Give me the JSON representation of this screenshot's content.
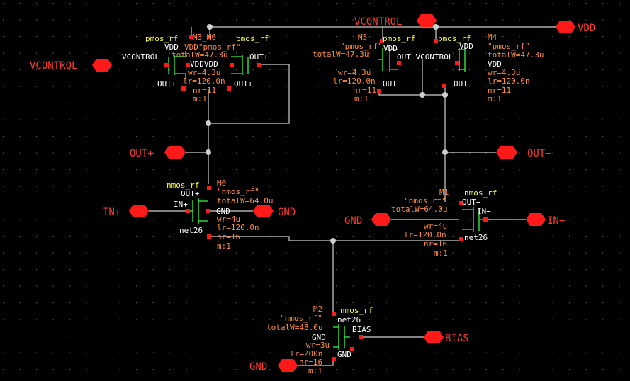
{
  "colors": {
    "background": "#000000",
    "wire": "#cfcfcf",
    "pin": "#ff1a1a",
    "pin_label": "#ff3b2f",
    "param": "#ff8c3a",
    "cell": "#ffff33",
    "net": "#ffffff",
    "device": "#33ff44",
    "grid": "#5a5a5a"
  },
  "pins": [
    {
      "id": "vcontrol-left",
      "label": "VCONTROL"
    },
    {
      "id": "vcontrol-top",
      "label": "VCONTROL"
    },
    {
      "id": "vdd",
      "label": "VDD"
    },
    {
      "id": "out-plus",
      "label": "OUT+"
    },
    {
      "id": "out-minus",
      "label": "OUT−"
    },
    {
      "id": "in-plus",
      "label": "IN+"
    },
    {
      "id": "gnd-m0",
      "label": "GND"
    },
    {
      "id": "gnd-m1",
      "label": "GND"
    },
    {
      "id": "in-minus",
      "label": "IN−"
    },
    {
      "id": "bias",
      "label": "BIAS"
    },
    {
      "id": "gnd-m2",
      "label": "GND"
    }
  ],
  "instances": {
    "m3m6": {
      "overlap_a": "pmos_rf",
      "overlap_b": "M3_M6",
      "overlap_c": "pmos_rf",
      "overlap_d": "VDD",
      "overlap_e": "VDD\"pmos_rf\"",
      "overlap_f": "totalW=47.3u",
      "overlap_g": "VCONTROL",
      "overlap_h": "VDDVDD",
      "overlap_i": "OUT+",
      "overlap_j": "wr=4.3u",
      "overlap_k": "OUT+",
      "overlap_l": "lr=120.0n",
      "overlap_m": "OUT+",
      "overlap_n": "nr=11",
      "overlap_o": "m:1"
    },
    "m5": {
      "name": "M5",
      "cell": "pmos_rf",
      "model": "\"pmos_rf\"",
      "totalW": "totalW=47.3u",
      "wr": "wr=4.3u",
      "lr": "lr=120.0n",
      "nr": "nr=11",
      "m": "m:1",
      "t_vdd": "VDD",
      "t_gate": "OUT−VCONTROL",
      "t_drain": "OUT−"
    },
    "m4": {
      "name": "M4",
      "cell": "pmos_rf",
      "model": "\"pmos_rf\"",
      "totalW": "totalW=47.3u",
      "wr": "wr=4.3u",
      "lr": "lr=120.0n",
      "nr": "nr=11",
      "m": "m:1",
      "t_vdd": "VDD",
      "t_vdd2": "VDD",
      "t_drain": "OUT−"
    },
    "m0": {
      "name": "M0",
      "cell": "nmos_rf",
      "model": "\"nmos_rf\"",
      "totalW": "totalW=64.0u",
      "wr": "wr=4u",
      "lr": "lr=120.0n",
      "nr": "nr=16",
      "m": "m:1",
      "t_drain": "OUT+",
      "t_gate": "IN+",
      "t_body": "GND",
      "t_source": "net26"
    },
    "m1": {
      "name": "M1",
      "cell": "nmos_rf",
      "model": "\"nmos_rf\"",
      "totalW": "totalW=64.0u",
      "wr": "wr=4u",
      "lr": "lr=120.0n",
      "nr": "nr=16",
      "m": "m:1",
      "t_drain": "OUT−",
      "t_gate": "IN−",
      "t_source": "net26"
    },
    "m2": {
      "name": "M2",
      "cell": "nmos_rf",
      "model": "\"nmos_rf\"",
      "totalW": "totalW=48.0u",
      "wr": "wr=3u",
      "lr": "lr=200n",
      "nr": "nr=16",
      "m": "m:1",
      "t_drain": "net26",
      "t_gate": "BIAS",
      "t_body": "GND",
      "t_source": "GND"
    }
  }
}
